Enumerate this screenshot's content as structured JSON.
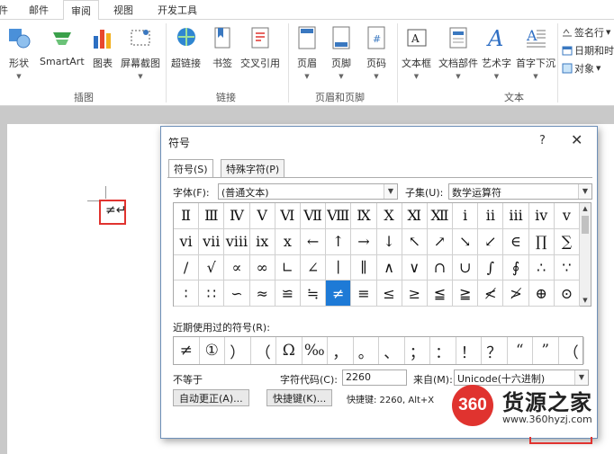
{
  "ribbon": {
    "tabs": [
      "件",
      "邮件",
      "审阅",
      "视图",
      "开发工具"
    ],
    "active_tab": "审阅",
    "buttons": {
      "shapes": "形状",
      "smartart": "SmartArt",
      "chart": "图表",
      "screenshot": "屏幕截图",
      "hyperlink": "超链接",
      "bookmark": "书签",
      "crossref": "交叉引用",
      "header": "页眉",
      "footer": "页脚",
      "pagenum": "页码",
      "textbox": "文本框",
      "quickparts": "文档部件",
      "wordart": "艺术字",
      "dropcap": "首字下沉"
    },
    "small": {
      "sigline": "签名行",
      "datetime": "日期和时",
      "object": "对象"
    },
    "groups": {
      "illustrations": "插图",
      "links": "链接",
      "headerfooter": "页眉和页脚",
      "text": "文本"
    }
  },
  "document": {
    "mark": "≠↵"
  },
  "dialog": {
    "title": "符号",
    "help": "?",
    "close": "✕",
    "tabs": [
      "符号(S)",
      "特殊字符(P)"
    ],
    "font_label": "字体(F):",
    "font_value": "(普通文本)",
    "subset_label": "子集(U):",
    "subset_value": "数学运算符",
    "symbols": [
      [
        "Ⅱ",
        "Ⅲ",
        "Ⅳ",
        "Ⅴ",
        "Ⅵ",
        "Ⅶ",
        "Ⅷ",
        "Ⅸ",
        "Ⅹ",
        "Ⅺ",
        "Ⅻ",
        "ⅰ",
        "ⅱ",
        "ⅲ",
        "ⅳ",
        "ⅴ"
      ],
      [
        "ⅵ",
        "ⅶ",
        "ⅷ",
        "ⅸ",
        "ⅹ",
        "←",
        "↑",
        "→",
        "↓",
        "↖",
        "↗",
        "↘",
        "↙",
        "∈",
        "∏",
        "∑"
      ],
      [
        "∕",
        "√",
        "∝",
        "∞",
        "∟",
        "∠",
        "∣",
        "∥",
        "∧",
        "∨",
        "∩",
        "∪",
        "∫",
        "∮",
        "∴",
        "∵"
      ],
      [
        "∶",
        "∷",
        "∽",
        "≈",
        "≌",
        "≒",
        "≠",
        "≡",
        "≤",
        "≥",
        "≦",
        "≧",
        "≮",
        "≯",
        "⊕",
        "⊙"
      ]
    ],
    "selected_symbol": "≠",
    "recent_label": "近期使用过的符号(R):",
    "recent": [
      "≠",
      "①",
      "）",
      "（",
      "Ω",
      "‰",
      "，",
      "。",
      "、",
      "；",
      "：",
      "！",
      "？",
      "“",
      "”",
      "（"
    ],
    "symbol_name": "不等于",
    "charcode_label": "字符代码(C):",
    "charcode_value": "2260",
    "from_label": "来自(M):",
    "from_value": "Unicode(十六进制)",
    "autocorrect_button": "自动更正(A)...",
    "shortcut_button": "快捷键(K)...",
    "shortcut_text": "快捷键: 2260, Alt+X"
  },
  "watermark": {
    "logo": "360",
    "name": "货源之家",
    "url": "www.360hyzj.com"
  }
}
